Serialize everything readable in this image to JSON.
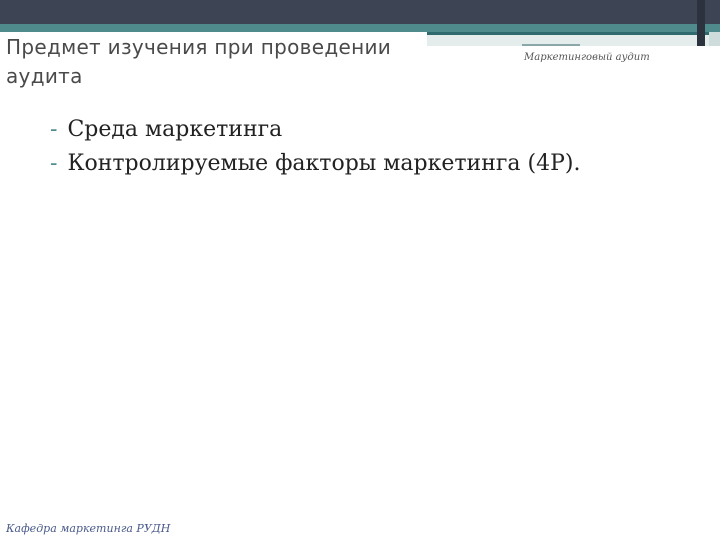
{
  "slide": {
    "title": "Предмет изучения при проведении аудита",
    "header_note": "Маркетинговый аудит",
    "bullets": [
      {
        "marker": "-",
        "text": "Среда маркетинга"
      },
      {
        "marker": "-",
        "text": "Контролируемые факторы маркетинга (4Р)."
      }
    ],
    "footer_note": "Кафедра маркетинга РУДН"
  },
  "colors": {
    "top_bar": "#3d4454",
    "accent": "#4f8a8c",
    "text": "#222222",
    "footer_text": "#4a5a8a"
  }
}
